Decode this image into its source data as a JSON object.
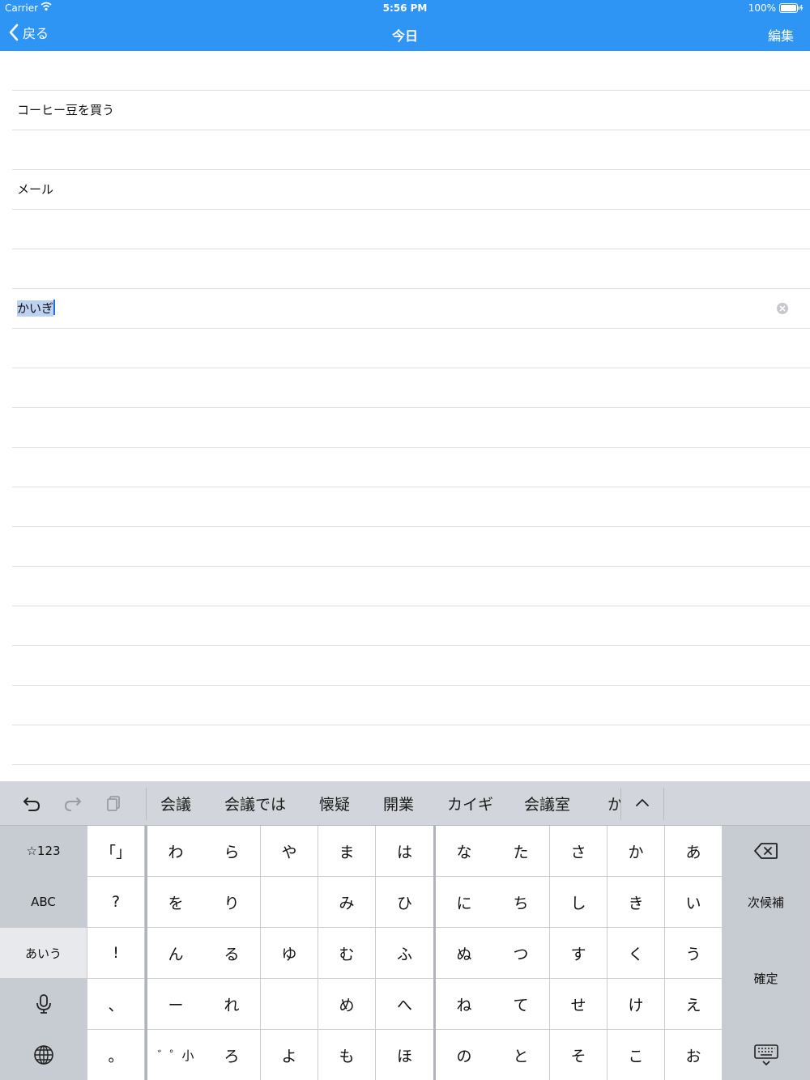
{
  "status_bar": {
    "carrier": "Carrier",
    "time": "5:56 PM",
    "battery": "100%"
  },
  "nav": {
    "back_label": "戻る",
    "title": "今日",
    "edit_label": "編集"
  },
  "list": {
    "rows": [
      {
        "text": ""
      },
      {
        "text": "コーヒー豆を買う"
      },
      {
        "text": ""
      },
      {
        "text": "メール"
      },
      {
        "text": ""
      },
      {
        "text": ""
      },
      {
        "text": "かいぎ",
        "editing": true
      },
      {
        "text": ""
      },
      {
        "text": ""
      },
      {
        "text": ""
      },
      {
        "text": ""
      },
      {
        "text": ""
      },
      {
        "text": ""
      },
      {
        "text": ""
      },
      {
        "text": ""
      },
      {
        "text": ""
      },
      {
        "text": ""
      },
      {
        "text": ""
      },
      {
        "text": ""
      }
    ]
  },
  "keyboard": {
    "candidates": [
      "会議",
      "会議では",
      "懐疑",
      "開業",
      "カイギ",
      "会議室",
      "か"
    ],
    "left_keys": [
      "☆123",
      "ABC",
      "あいう",
      "mic-icon",
      "globe-icon"
    ],
    "col_punct": [
      "「」",
      "?",
      "!",
      "、",
      "。"
    ],
    "kana_columns": [
      [
        "わ",
        "を",
        "ん",
        "ー",
        "゛゜小"
      ],
      [
        "ら",
        "り",
        "る",
        "れ",
        "ろ"
      ],
      [
        "や",
        "",
        "ゆ",
        "",
        "よ"
      ],
      [
        "ま",
        "み",
        "む",
        "め",
        "も"
      ],
      [
        "は",
        "ひ",
        "ふ",
        "へ",
        "ほ"
      ],
      [
        "な",
        "に",
        "ぬ",
        "ね",
        "の"
      ],
      [
        "た",
        "ち",
        "つ",
        "て",
        "と"
      ],
      [
        "さ",
        "し",
        "す",
        "せ",
        "そ"
      ],
      [
        "か",
        "き",
        "く",
        "け",
        "こ"
      ],
      [
        "あ",
        "い",
        "う",
        "え",
        "お"
      ]
    ],
    "next_candidate_label": "次候補",
    "confirm_label": "確定",
    "active_mode": "あいう"
  },
  "colors": {
    "accent": "#2f95f5",
    "selection": "#bcd2f0",
    "keyboard_bg": "#cfd3d9"
  }
}
